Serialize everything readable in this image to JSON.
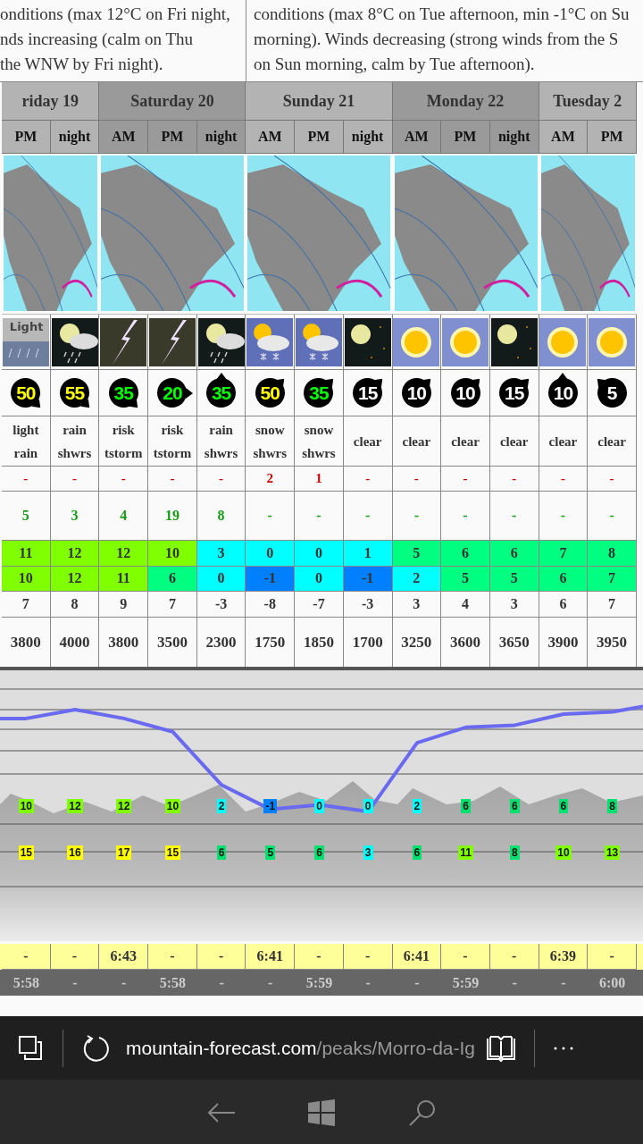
{
  "intro": {
    "left_lines": [
      "onditions (max 12°C on Fri night,",
      "nds increasing (calm on Thu",
      "the WNW by Fri night)."
    ],
    "right_lines": [
      "conditions (max 8°C on Tue afternoon, min -1°C on Su",
      "morning). Winds decreasing (strong winds from the S",
      "on Sun morning, calm by Tue afternoon)."
    ]
  },
  "days": [
    {
      "label": "riday 19",
      "periods": [
        "PM",
        "night"
      ]
    },
    {
      "label": "Saturday 20",
      "periods": [
        "AM",
        "PM",
        "night"
      ]
    },
    {
      "label": "Sunday 21",
      "periods": [
        "AM",
        "PM",
        "night"
      ]
    },
    {
      "label": "Monday 22",
      "periods": [
        "AM",
        "PM",
        "night"
      ]
    },
    {
      "label": "Tuesday 2",
      "periods": [
        "AM",
        "PM"
      ]
    }
  ],
  "weather_icons": [
    {
      "kind": "light-rain",
      "caption": "Light"
    },
    {
      "kind": "rain-night"
    },
    {
      "kind": "tstorm"
    },
    {
      "kind": "tstorm"
    },
    {
      "kind": "rain-night"
    },
    {
      "kind": "snow-day"
    },
    {
      "kind": "snow-day"
    },
    {
      "kind": "clear-night"
    },
    {
      "kind": "clear-day"
    },
    {
      "kind": "clear-day"
    },
    {
      "kind": "clear-night"
    },
    {
      "kind": "clear-day"
    },
    {
      "kind": "clear-day"
    }
  ],
  "wind": [
    {
      "speed": "50",
      "color": "#ffff00",
      "kind": "arrow-se"
    },
    {
      "speed": "55",
      "color": "#ffff00",
      "kind": "arrow-se"
    },
    {
      "speed": "35",
      "color": "#00ff00",
      "kind": "arrow-se"
    },
    {
      "speed": "20",
      "color": "#00ff00",
      "kind": "arrow-e"
    },
    {
      "speed": "35",
      "color": "#00ff00",
      "kind": "arrow-n"
    },
    {
      "speed": "50",
      "color": "#ffff00",
      "kind": "arrow-ne"
    },
    {
      "speed": "35",
      "color": "#00ff00",
      "kind": "arrow-ne"
    },
    {
      "speed": "15",
      "color": "#ffffff",
      "kind": "arrow-ne"
    },
    {
      "speed": "10",
      "color": "#ffffff",
      "kind": "arrow-ne"
    },
    {
      "speed": "10",
      "color": "#ffffff",
      "kind": "arrow-ne"
    },
    {
      "speed": "15",
      "color": "#ffffff",
      "kind": "arrow-ne"
    },
    {
      "speed": "10",
      "color": "#ffffff",
      "kind": "arrow-n"
    },
    {
      "speed": "5",
      "color": "#ffffff",
      "kind": "arrow-nw"
    }
  ],
  "summary": [
    "light rain",
    "rain shwrs",
    "risk tstorm",
    "risk tstorm",
    "rain shwrs",
    "snow shwrs",
    "snow shwrs",
    "clear",
    "clear",
    "clear",
    "clear",
    "clear",
    "clear"
  ],
  "snow": [
    "-",
    "-",
    "-",
    "-",
    "-",
    "2",
    "1",
    "-",
    "-",
    "-",
    "-",
    "-",
    "-"
  ],
  "rain": [
    "5",
    "3",
    "4",
    "19",
    "8",
    "-",
    "-",
    "-",
    "-",
    "-",
    "-",
    "-",
    "-"
  ],
  "max_temp": [
    {
      "value": "11",
      "color": "#80ff00"
    },
    {
      "value": "12",
      "color": "#80ff00"
    },
    {
      "value": "12",
      "color": "#80ff00"
    },
    {
      "value": "10",
      "color": "#80ff00"
    },
    {
      "value": "3",
      "color": "#00ffff"
    },
    {
      "value": "0",
      "color": "#00ffff"
    },
    {
      "value": "0",
      "color": "#00ffff"
    },
    {
      "value": "1",
      "color": "#00ffff"
    },
    {
      "value": "5",
      "color": "#00ff80"
    },
    {
      "value": "6",
      "color": "#00ff80"
    },
    {
      "value": "6",
      "color": "#00ff80"
    },
    {
      "value": "7",
      "color": "#00ff80"
    },
    {
      "value": "8",
      "color": "#00ff80"
    }
  ],
  "min_temp": [
    {
      "value": "10",
      "color": "#80ff00"
    },
    {
      "value": "12",
      "color": "#80ff00"
    },
    {
      "value": "11",
      "color": "#80ff00"
    },
    {
      "value": "6",
      "color": "#00ff80"
    },
    {
      "value": "0",
      "color": "#00ffff"
    },
    {
      "value": "-1",
      "color": "#0080ff"
    },
    {
      "value": "0",
      "color": "#00ffff"
    },
    {
      "value": "-1",
      "color": "#0080ff"
    },
    {
      "value": "2",
      "color": "#00ffff"
    },
    {
      "value": "5",
      "color": "#00ff80"
    },
    {
      "value": "5",
      "color": "#00ff80"
    },
    {
      "value": "6",
      "color": "#00ff80"
    },
    {
      "value": "7",
      "color": "#00ff80"
    }
  ],
  "chill": [
    "7",
    "8",
    "9",
    "7",
    "-3",
    "-8",
    "-7",
    "-3",
    "3",
    "4",
    "3",
    "6",
    "7"
  ],
  "freezing_level": [
    "3800",
    "4000",
    "3800",
    "3500",
    "2300",
    "1750",
    "1850",
    "1700",
    "3250",
    "3600",
    "3650",
    "3900",
    "3950"
  ],
  "chart_temps": [
    {
      "value": "10",
      "color": "#80ff00"
    },
    {
      "value": "12",
      "color": "#80ff00"
    },
    {
      "value": "12",
      "color": "#80ff00"
    },
    {
      "value": "10",
      "color": "#80ff00"
    },
    {
      "value": "2",
      "color": "#00ffff"
    },
    {
      "value": "-1",
      "color": "#0080ff"
    },
    {
      "value": "0",
      "color": "#00ffff"
    },
    {
      "value": "0",
      "color": "#00ffff"
    },
    {
      "value": "2",
      "color": "#00ffff"
    },
    {
      "value": "6",
      "color": "#00e070"
    },
    {
      "value": "6",
      "color": "#00e070"
    },
    {
      "value": "6",
      "color": "#00e070"
    },
    {
      "value": "8",
      "color": "#00e070"
    }
  ],
  "chart_winds": [
    {
      "value": "15",
      "color": "#ffff00"
    },
    {
      "value": "16",
      "color": "#ffff00"
    },
    {
      "value": "17",
      "color": "#ffff00"
    },
    {
      "value": "15",
      "color": "#ffff00"
    },
    {
      "value": "6",
      "color": "#00e070"
    },
    {
      "value": "5",
      "color": "#00e070"
    },
    {
      "value": "6",
      "color": "#00e070"
    },
    {
      "value": "3",
      "color": "#00ffff"
    },
    {
      "value": "6",
      "color": "#00e070"
    },
    {
      "value": "11",
      "color": "#80ff00"
    },
    {
      "value": "8",
      "color": "#00e070"
    },
    {
      "value": "10",
      "color": "#80ff00"
    },
    {
      "value": "13",
      "color": "#80ff00"
    }
  ],
  "sunrise": [
    "-",
    "-",
    "6:43",
    "-",
    "-",
    "6:41",
    "-",
    "-",
    "6:41",
    "-",
    "-",
    "6:39",
    "-"
  ],
  "sunset": [
    "5:58",
    "-",
    "-",
    "5:58",
    "-",
    "-",
    "5:59",
    "-",
    "-",
    "5:59",
    "-",
    "-",
    "6:00"
  ],
  "browser": {
    "url_host": "mountain-forecast.com",
    "url_path": "/peaks/Morro-da-Ig"
  }
}
